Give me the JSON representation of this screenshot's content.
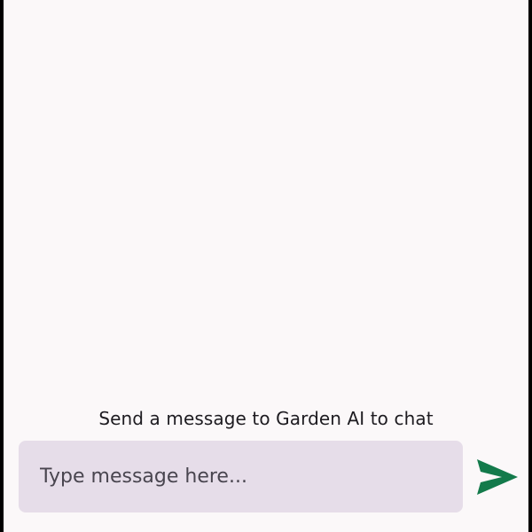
{
  "chat": {
    "empty_hint": "Send a message to Garden AI to chat"
  },
  "composer": {
    "placeholder": "Type message here...",
    "value": ""
  },
  "send_button": {
    "icon": "send-icon",
    "color": "#137a4b"
  },
  "colors": {
    "background": "#fbf8f9",
    "input_background": "#e6dde9",
    "text": "#1d1b20",
    "placeholder": "#49454f"
  }
}
